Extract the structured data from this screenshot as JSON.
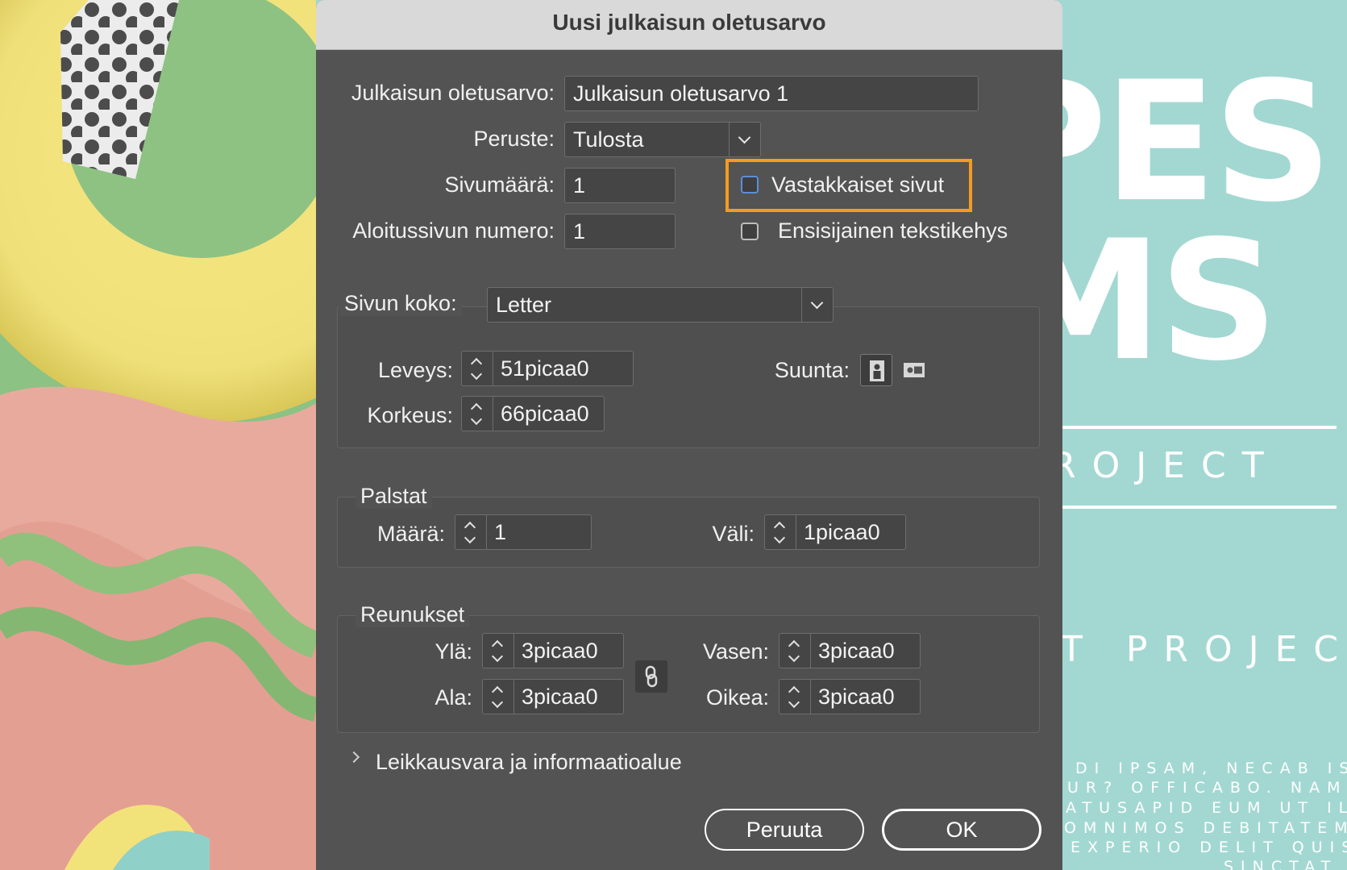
{
  "dialog": {
    "title": "Uusi julkaisun oletusarvo"
  },
  "preset": {
    "label": "Julkaisun oletusarvo:",
    "value": "Julkaisun oletusarvo 1"
  },
  "intent": {
    "label": "Peruste:",
    "value": "Tulosta"
  },
  "pages": {
    "label": "Sivumäärä:",
    "value": "1"
  },
  "facing_pages": {
    "label": "Vastakkaiset sivut",
    "checked": false,
    "highlight_color": "#f39c1f"
  },
  "start_page": {
    "label": "Aloitussivun numero:",
    "value": "1"
  },
  "primary_text_frame": {
    "label": "Ensisijainen tekstikehys",
    "checked": false
  },
  "page_size": {
    "label": "Sivun koko:",
    "value": "Letter",
    "width_label": "Leveys:",
    "width_value": "51picaa0",
    "height_label": "Korkeus:",
    "height_value": "66picaa0",
    "orientation_label": "Suunta:",
    "orientation_icons": [
      "portrait-icon",
      "landscape-icon"
    ],
    "orientation_selected": "portrait"
  },
  "columns": {
    "title": "Palstat",
    "number_label": "Määrä:",
    "number_value": "1",
    "gutter_label": "Väli:",
    "gutter_value": "1picaa0"
  },
  "margins": {
    "title": "Reunukset",
    "top_label": "Ylä:",
    "top_value": "3picaa0",
    "bottom_label": "Ala:",
    "bottom_value": "3picaa0",
    "left_label": "Vasen:",
    "left_value": "3picaa0",
    "right_label": "Oikea:",
    "right_value": "3picaa0",
    "link_icon": "link-icon"
  },
  "bleed": {
    "label": "Leikkausvara ja informaatioalue",
    "expanded": false
  },
  "buttons": {
    "cancel": "Peruuta",
    "ok": "OK"
  },
  "background_poster": {
    "big_line1": "PES",
    "big_line2": "MS",
    "spaced_line1": "ROJECT",
    "spaced_line2": "T PROJECT",
    "small_lines": [
      "DI IPSAM, NECAB IS",
      "UR? OFFICABO. NAM",
      "ATUSAPID EUM UT IL",
      "OMNIMOS DEBITATEM",
      "EXPERIO DELIT QUIS",
      "SINCTAT"
    ]
  }
}
